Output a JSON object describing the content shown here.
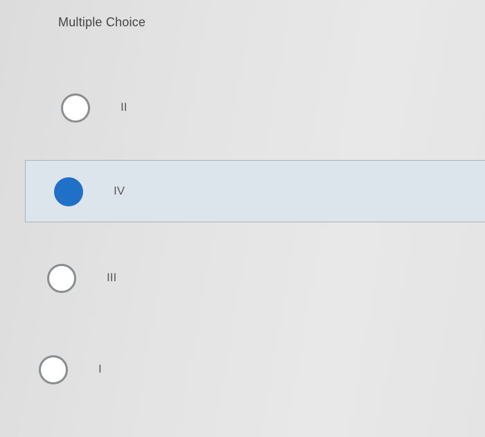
{
  "question": {
    "header": "Multiple Choice"
  },
  "options": [
    {
      "label": "II",
      "selected": false
    },
    {
      "label": "IV",
      "selected": true
    },
    {
      "label": "III",
      "selected": false
    },
    {
      "label": "I",
      "selected": false
    }
  ],
  "colors": {
    "selected_radio": "#1f70c6",
    "selected_background": "#dde5ec",
    "radio_border": "#8a8d90"
  }
}
